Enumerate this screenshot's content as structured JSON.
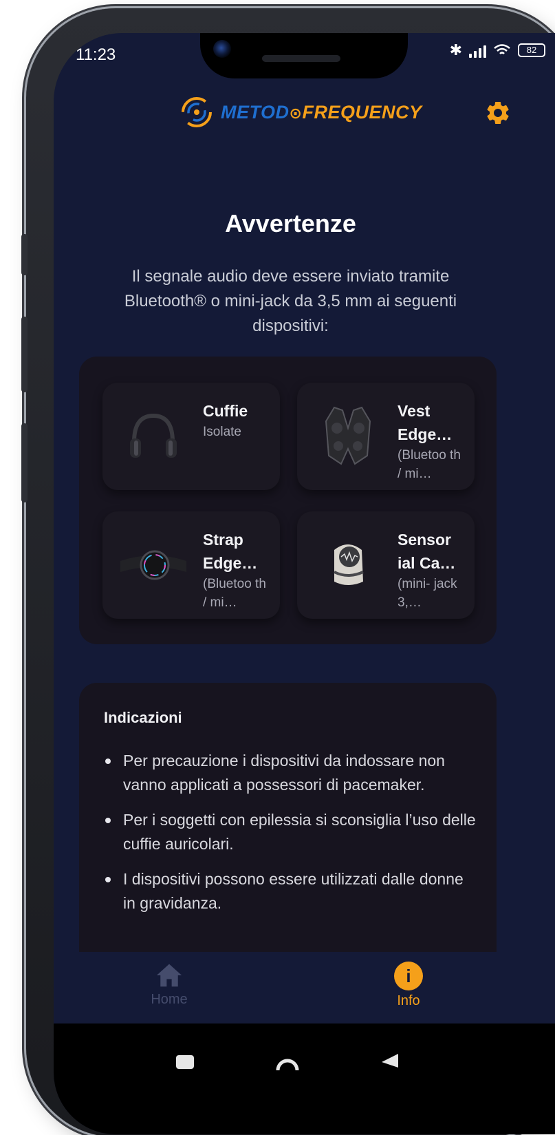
{
  "status_bar": {
    "time": "11:23",
    "battery": "82",
    "icons": [
      "bluetooth-icon",
      "signal-icon",
      "wifi-icon",
      "battery-icon"
    ]
  },
  "header": {
    "logo_part1": "METOD",
    "logo_part2": "FREQUENCY",
    "settings_icon": "gear-icon"
  },
  "page": {
    "title": "Avvertenze",
    "subtitle": "Il segnale audio deve essere inviato tramite Bluetooth® o mini-jack da 3,5 mm ai seguenti dispositivi:"
  },
  "devices": [
    {
      "name": "Cuffie",
      "desc": "Isolate",
      "icon": "headphones"
    },
    {
      "name": "Vest Edge…",
      "desc": "(Bluetoo th / mi…",
      "icon": "vest"
    },
    {
      "name": "Strap Edge…",
      "desc": "(Bluetoo th / mi…",
      "icon": "strap"
    },
    {
      "name": "Sensor ial Ca…",
      "desc": "(mini- jack 3,…",
      "icon": "sensorial-cap"
    }
  ],
  "indications": {
    "title": "Indicazioni",
    "items": [
      "Per precauzione i dispositivi da indossare non vanno applicati a possessori di pacemaker.",
      "Per i soggetti con epilessia si sconsiglia l’uso delle cuffie auricolari.",
      "I dispositivi possono essere utilizzati dalle donne in gravidanza."
    ]
  },
  "bottom_nav": {
    "home_label": "Home",
    "info_label": "Info",
    "active": "Info",
    "info_glyph": "i"
  },
  "colors": {
    "background": "#141a37",
    "card": "#17141f",
    "accent": "#f5a01a",
    "brand_blue": "#1f6fd0"
  }
}
